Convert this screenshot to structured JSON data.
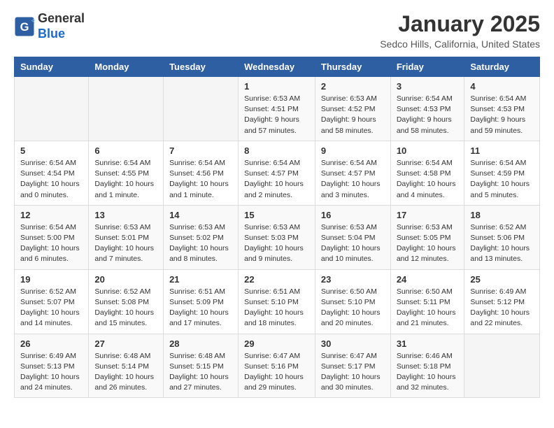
{
  "header": {
    "logo_line1": "General",
    "logo_line2": "Blue",
    "month": "January 2025",
    "location": "Sedco Hills, California, United States"
  },
  "weekdays": [
    "Sunday",
    "Monday",
    "Tuesday",
    "Wednesday",
    "Thursday",
    "Friday",
    "Saturday"
  ],
  "weeks": [
    [
      {
        "day": "",
        "info": ""
      },
      {
        "day": "",
        "info": ""
      },
      {
        "day": "",
        "info": ""
      },
      {
        "day": "1",
        "info": "Sunrise: 6:53 AM\nSunset: 4:51 PM\nDaylight: 9 hours and 57 minutes."
      },
      {
        "day": "2",
        "info": "Sunrise: 6:53 AM\nSunset: 4:52 PM\nDaylight: 9 hours and 58 minutes."
      },
      {
        "day": "3",
        "info": "Sunrise: 6:54 AM\nSunset: 4:53 PM\nDaylight: 9 hours and 58 minutes."
      },
      {
        "day": "4",
        "info": "Sunrise: 6:54 AM\nSunset: 4:53 PM\nDaylight: 9 hours and 59 minutes."
      }
    ],
    [
      {
        "day": "5",
        "info": "Sunrise: 6:54 AM\nSunset: 4:54 PM\nDaylight: 10 hours and 0 minutes."
      },
      {
        "day": "6",
        "info": "Sunrise: 6:54 AM\nSunset: 4:55 PM\nDaylight: 10 hours and 1 minute."
      },
      {
        "day": "7",
        "info": "Sunrise: 6:54 AM\nSunset: 4:56 PM\nDaylight: 10 hours and 1 minute."
      },
      {
        "day": "8",
        "info": "Sunrise: 6:54 AM\nSunset: 4:57 PM\nDaylight: 10 hours and 2 minutes."
      },
      {
        "day": "9",
        "info": "Sunrise: 6:54 AM\nSunset: 4:57 PM\nDaylight: 10 hours and 3 minutes."
      },
      {
        "day": "10",
        "info": "Sunrise: 6:54 AM\nSunset: 4:58 PM\nDaylight: 10 hours and 4 minutes."
      },
      {
        "day": "11",
        "info": "Sunrise: 6:54 AM\nSunset: 4:59 PM\nDaylight: 10 hours and 5 minutes."
      }
    ],
    [
      {
        "day": "12",
        "info": "Sunrise: 6:54 AM\nSunset: 5:00 PM\nDaylight: 10 hours and 6 minutes."
      },
      {
        "day": "13",
        "info": "Sunrise: 6:53 AM\nSunset: 5:01 PM\nDaylight: 10 hours and 7 minutes."
      },
      {
        "day": "14",
        "info": "Sunrise: 6:53 AM\nSunset: 5:02 PM\nDaylight: 10 hours and 8 minutes."
      },
      {
        "day": "15",
        "info": "Sunrise: 6:53 AM\nSunset: 5:03 PM\nDaylight: 10 hours and 9 minutes."
      },
      {
        "day": "16",
        "info": "Sunrise: 6:53 AM\nSunset: 5:04 PM\nDaylight: 10 hours and 10 minutes."
      },
      {
        "day": "17",
        "info": "Sunrise: 6:53 AM\nSunset: 5:05 PM\nDaylight: 10 hours and 12 minutes."
      },
      {
        "day": "18",
        "info": "Sunrise: 6:52 AM\nSunset: 5:06 PM\nDaylight: 10 hours and 13 minutes."
      }
    ],
    [
      {
        "day": "19",
        "info": "Sunrise: 6:52 AM\nSunset: 5:07 PM\nDaylight: 10 hours and 14 minutes."
      },
      {
        "day": "20",
        "info": "Sunrise: 6:52 AM\nSunset: 5:08 PM\nDaylight: 10 hours and 15 minutes."
      },
      {
        "day": "21",
        "info": "Sunrise: 6:51 AM\nSunset: 5:09 PM\nDaylight: 10 hours and 17 minutes."
      },
      {
        "day": "22",
        "info": "Sunrise: 6:51 AM\nSunset: 5:10 PM\nDaylight: 10 hours and 18 minutes."
      },
      {
        "day": "23",
        "info": "Sunrise: 6:50 AM\nSunset: 5:10 PM\nDaylight: 10 hours and 20 minutes."
      },
      {
        "day": "24",
        "info": "Sunrise: 6:50 AM\nSunset: 5:11 PM\nDaylight: 10 hours and 21 minutes."
      },
      {
        "day": "25",
        "info": "Sunrise: 6:49 AM\nSunset: 5:12 PM\nDaylight: 10 hours and 22 minutes."
      }
    ],
    [
      {
        "day": "26",
        "info": "Sunrise: 6:49 AM\nSunset: 5:13 PM\nDaylight: 10 hours and 24 minutes."
      },
      {
        "day": "27",
        "info": "Sunrise: 6:48 AM\nSunset: 5:14 PM\nDaylight: 10 hours and 26 minutes."
      },
      {
        "day": "28",
        "info": "Sunrise: 6:48 AM\nSunset: 5:15 PM\nDaylight: 10 hours and 27 minutes."
      },
      {
        "day": "29",
        "info": "Sunrise: 6:47 AM\nSunset: 5:16 PM\nDaylight: 10 hours and 29 minutes."
      },
      {
        "day": "30",
        "info": "Sunrise: 6:47 AM\nSunset: 5:17 PM\nDaylight: 10 hours and 30 minutes."
      },
      {
        "day": "31",
        "info": "Sunrise: 6:46 AM\nSunset: 5:18 PM\nDaylight: 10 hours and 32 minutes."
      },
      {
        "day": "",
        "info": ""
      }
    ]
  ]
}
